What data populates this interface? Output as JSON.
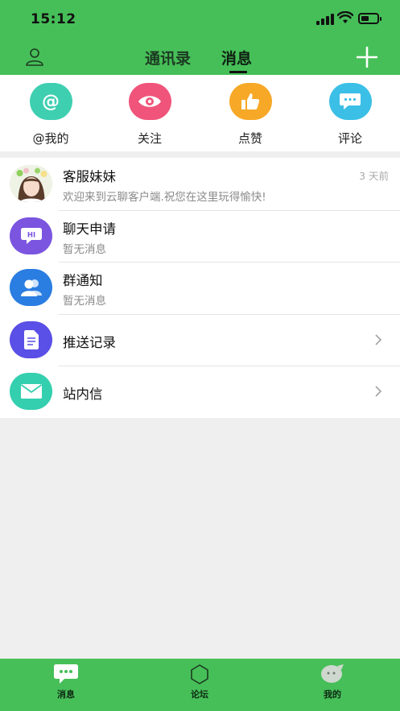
{
  "status_bar": {
    "time": "15:12"
  },
  "header": {
    "tabs": [
      {
        "label": "通讯录",
        "active": false
      },
      {
        "label": "消息",
        "active": true
      }
    ]
  },
  "quick_actions": [
    {
      "label": "@我的",
      "icon": "at-icon",
      "color": "#3ecfb0"
    },
    {
      "label": "关注",
      "icon": "eye-icon",
      "color": "#f0547a"
    },
    {
      "label": "点赞",
      "icon": "thumbs-up-icon",
      "color": "#f7a827"
    },
    {
      "label": "评论",
      "icon": "chat-bubble-icon",
      "color": "#3bbfe6"
    }
  ],
  "messages": [
    {
      "title": "客服妹妹",
      "subtitle": "欢迎来到云聊客户端.祝您在这里玩得愉快!",
      "time": "3 天前",
      "icon": "avatar-photo"
    },
    {
      "title": "聊天申请",
      "subtitle": "暂无消息",
      "icon": "hi-chat-icon",
      "color": "#7b55e0"
    },
    {
      "title": "群通知",
      "subtitle": "暂无消息",
      "icon": "group-icon",
      "color": "#2a7de1"
    },
    {
      "title": "推送记录",
      "icon": "document-icon",
      "color": "#5a4fe6"
    },
    {
      "title": "站内信",
      "icon": "envelope-icon",
      "color": "#34cfae"
    }
  ],
  "bottom_nav": [
    {
      "label": "消息",
      "icon": "message-icon",
      "active": true
    },
    {
      "label": "论坛",
      "icon": "forum-hexagon-icon",
      "active": false
    },
    {
      "label": "我的",
      "icon": "profile-icon",
      "active": false
    }
  ],
  "colors": {
    "primary": "#46bf58",
    "background": "#efefef"
  }
}
